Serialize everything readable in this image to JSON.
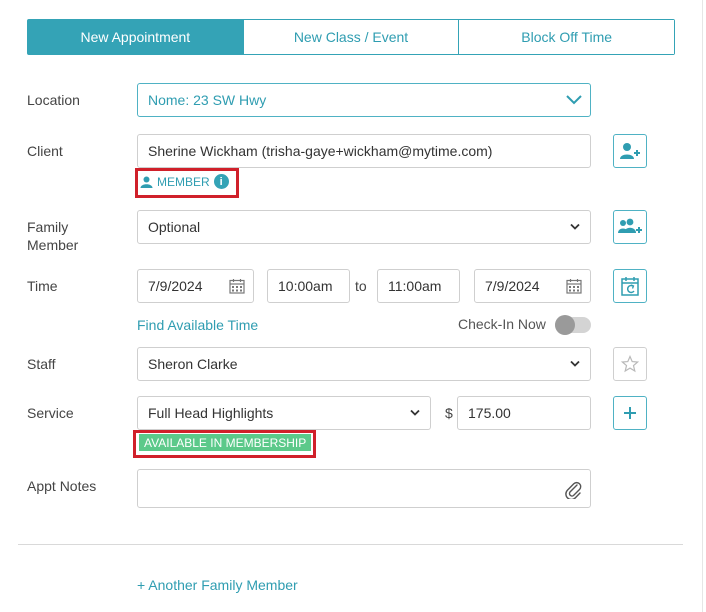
{
  "tabs": [
    {
      "label": "New Appointment",
      "active": true
    },
    {
      "label": "New Class / Event",
      "active": false
    },
    {
      "label": "Block Off Time",
      "active": false
    }
  ],
  "location": {
    "label": "Location",
    "value": "Nome: 23 SW Hwy"
  },
  "client": {
    "label": "Client",
    "value": "Sherine Wickham (trisha-gaye+wickham@mytime.com)",
    "member_badge": "MEMBER",
    "info_glyph": "i"
  },
  "family": {
    "label_line1": "Family",
    "label_line2": "Member",
    "value": "Optional"
  },
  "time": {
    "label": "Time",
    "start_date": "7/9/2024",
    "start_time": "10:00am",
    "to": "to",
    "end_time": "11:00am",
    "end_date": "7/9/2024",
    "find_link": "Find Available Time",
    "checkin_label": "Check-In Now",
    "checkin_on": false
  },
  "staff": {
    "label": "Staff",
    "value": "Sheron Clarke"
  },
  "service": {
    "label": "Service",
    "value": "Full Head Highlights",
    "currency": "$",
    "price": "175.00",
    "membership_badge": "AVAILABLE IN MEMBERSHIP"
  },
  "notes": {
    "label": "Appt Notes",
    "value": ""
  },
  "another_family_link": "+ Another Family Member",
  "colors": {
    "accent": "#34a3b6",
    "highlight": "#d0202a",
    "badge_green": "#5cc98a"
  }
}
